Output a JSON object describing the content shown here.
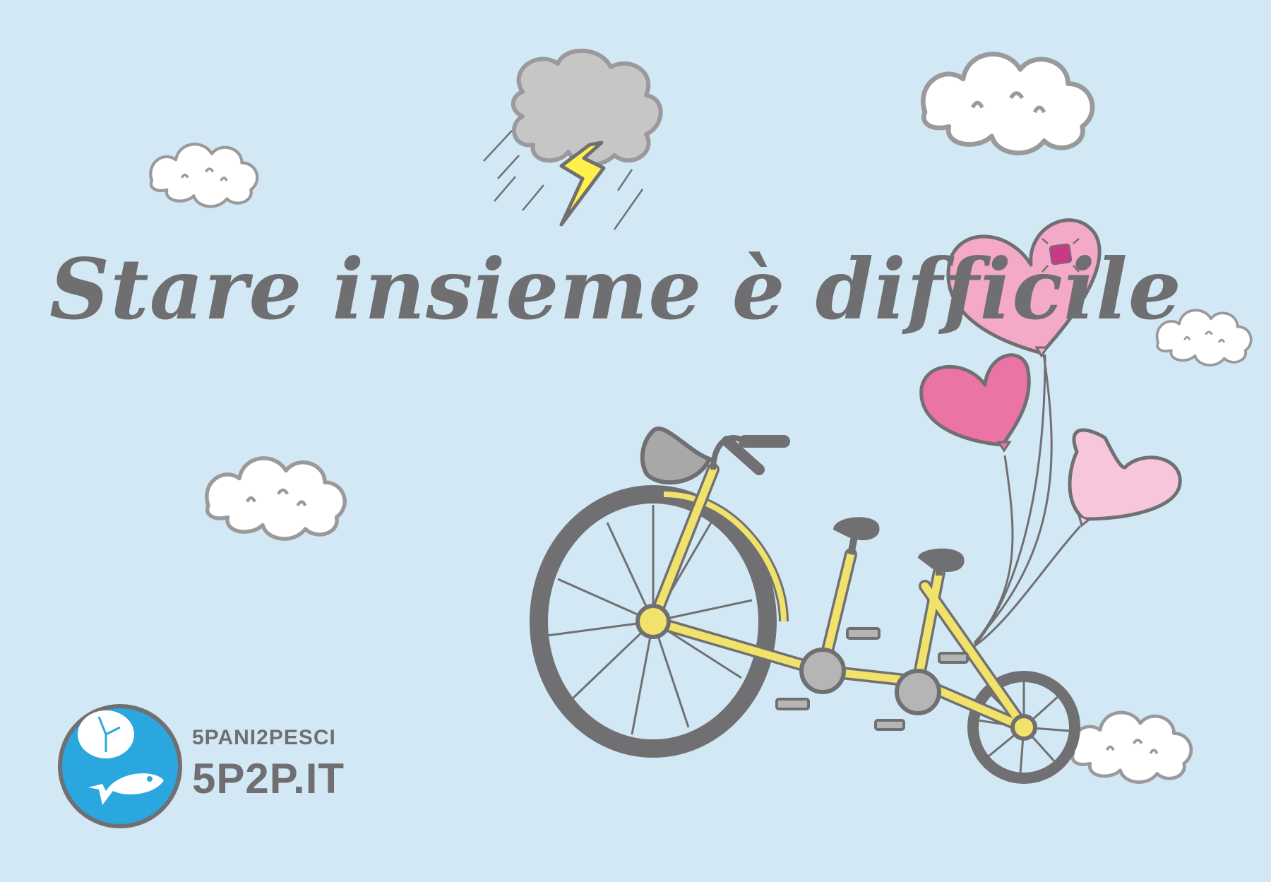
{
  "headline": "Stare insieme è difficile",
  "brand": {
    "name": "5PANI2PESCI",
    "url": "5P2P.IT"
  },
  "colors": {
    "background": "#d3e8f5",
    "text": "#6f6f71",
    "bike_frame": "#f0e26a",
    "outline": "#707072",
    "logo": "#2aa7df",
    "heart_light": "#f5a9c8",
    "heart_dark": "#ec73a5",
    "heart_pale": "#f7c6da",
    "patch": "#c83a83",
    "lightning": "#fff04a",
    "storm_cloud": "#c6c6c6"
  },
  "icons": [
    "storm-cloud-icon",
    "lightning-icon",
    "cloud-icon",
    "heart-balloon-icon",
    "bicycle-icon",
    "fish-logo-icon"
  ]
}
